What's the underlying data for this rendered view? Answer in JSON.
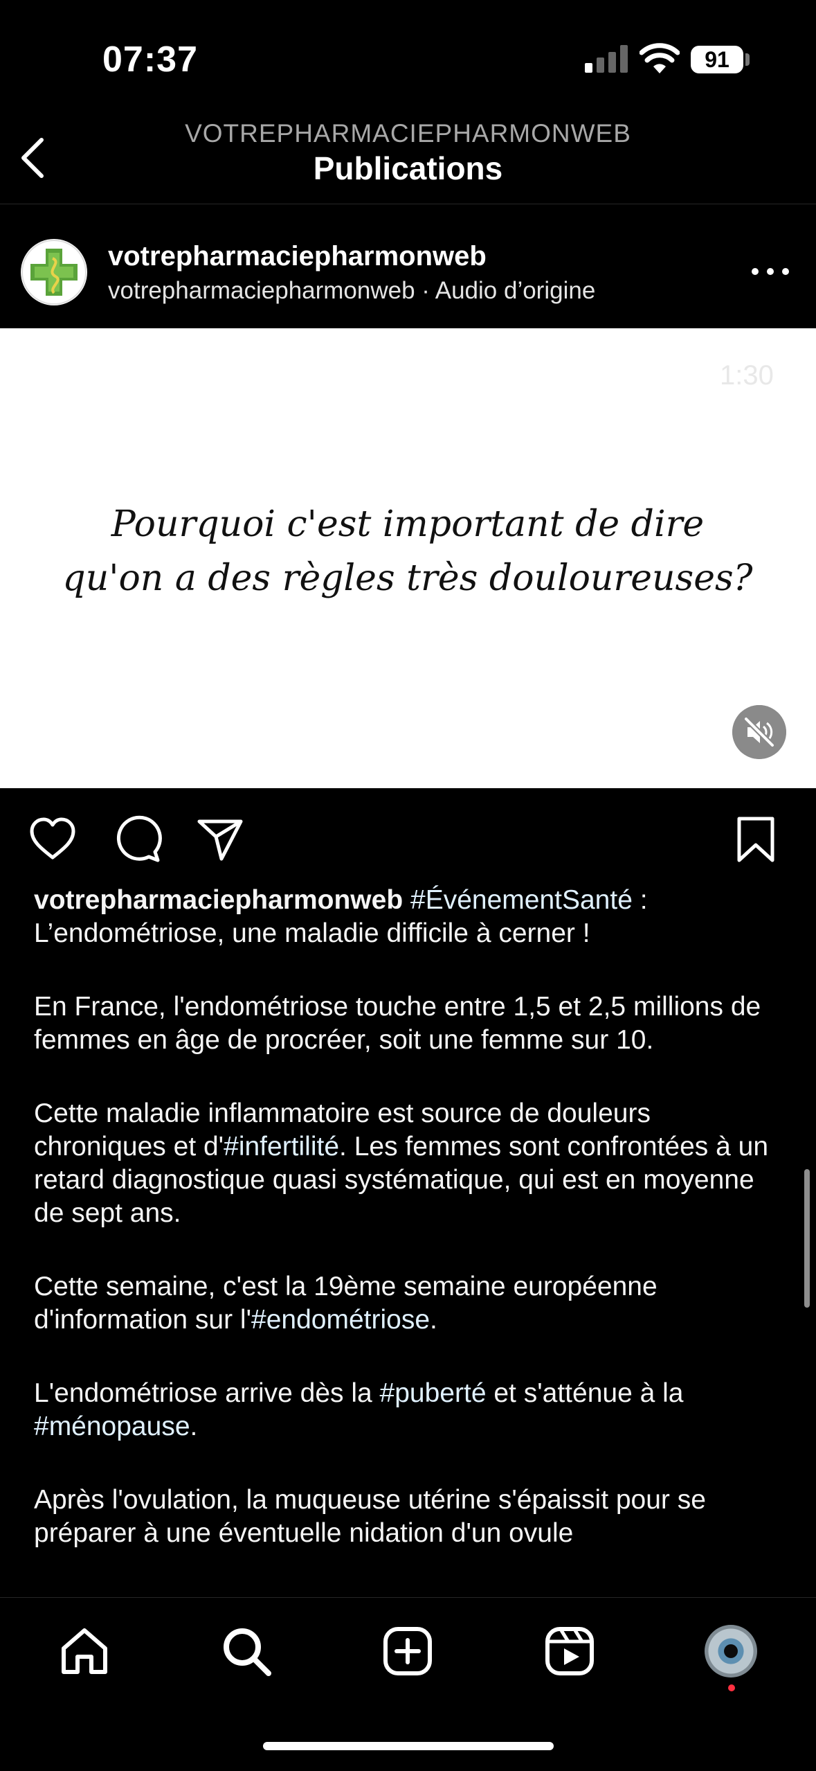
{
  "status_bar": {
    "time": "07:37",
    "battery": "91"
  },
  "header": {
    "subtitle": "VOTREPHARMACIEPHARMONWEB",
    "title": "Publications"
  },
  "post": {
    "username": "votrepharmaciepharmonweb",
    "subline": "votrepharmaciepharmonweb · Audio d’origine",
    "media": {
      "duration": "1:30",
      "line1": "Pourquoi c'est important de dire",
      "line2": "qu'on a des règles très douloureuses?"
    },
    "caption": {
      "username": "votrepharmaciepharmonweb",
      "p1_tag": "#ÉvénementSanté",
      "p1_text": " : L’endométriose, une maladie difficile à cerner !",
      "p2": "En France, l'endométriose touche entre 1,5 et 2,5 millions de femmes en âge de procréer, soit une femme sur 10.",
      "p3_a": "Cette maladie inflammatoire est source de douleurs chroniques et d'",
      "p3_tag": "#infertilité",
      "p3_b": ". Les femmes sont confrontées à un retard diagnostique quasi systématique, qui est en moyenne de sept ans.",
      "p4_a": "Cette semaine, c'est la 19ème semaine européenne d'information sur l'",
      "p4_tag": "#endométriose",
      "p4_b": ".",
      "p5_a": "L'endométriose arrive dès la ",
      "p5_tag1": "#puberté",
      "p5_b": " et s'atténue à la ",
      "p5_tag2": "#ménopause",
      "p5_c": ".",
      "p6": "Après l'ovulation, la muqueuse utérine s'épaissit pour se préparer à une éventuelle nidation d'un ovule"
    }
  },
  "colors": {
    "background": "#000000",
    "hashtag": "#e0f1ff",
    "muted": "#a8a8a8",
    "notification": "#ff3040"
  },
  "icons": {
    "back": "chevron-left-icon",
    "more": "more-icon",
    "like": "heart-icon",
    "comment": "comment-icon",
    "share": "send-icon",
    "save": "bookmark-icon",
    "mute": "speaker-muted-icon",
    "home": "home-icon",
    "search": "search-icon",
    "create": "plus-square-icon",
    "reels": "reels-icon",
    "profile": "profile-avatar"
  }
}
